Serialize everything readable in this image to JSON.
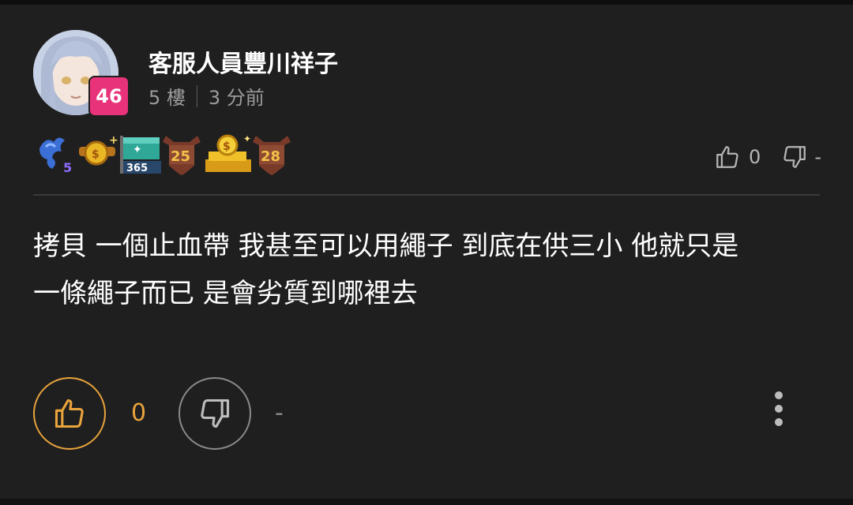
{
  "post": {
    "author": "客服人員豐川祥子",
    "level": "46",
    "floor": "5 樓",
    "time": "3 分前",
    "content_line1": "拷貝 一個止血帶 我甚至可以用繩子 到底在供三小 他就只是",
    "content_line2": "一條繩子而已 是會劣質到哪裡去"
  },
  "header_votes": {
    "like_count": "0",
    "dislike_label": "-",
    "like_icon": "thumbs-up-icon",
    "dislike_icon": "thumbs-down-icon"
  },
  "badges": [
    {
      "name": "dragon-badge",
      "label": "5"
    },
    {
      "name": "coin-plus-badge",
      "label": ""
    },
    {
      "name": "flag-365-badge",
      "label": "365"
    },
    {
      "name": "shield-25-badge",
      "label": "25"
    },
    {
      "name": "gold-coins-badge",
      "label": ""
    },
    {
      "name": "shield-28-badge",
      "label": "28"
    }
  ],
  "actions": {
    "like_count": "0",
    "dislike_label": "-",
    "more_icon": "more-vertical-icon"
  },
  "colors": {
    "background": "#1f1f1f",
    "level_badge": "#e8337a",
    "like_accent": "#e8a33c",
    "muted": "#9b9b9b"
  }
}
